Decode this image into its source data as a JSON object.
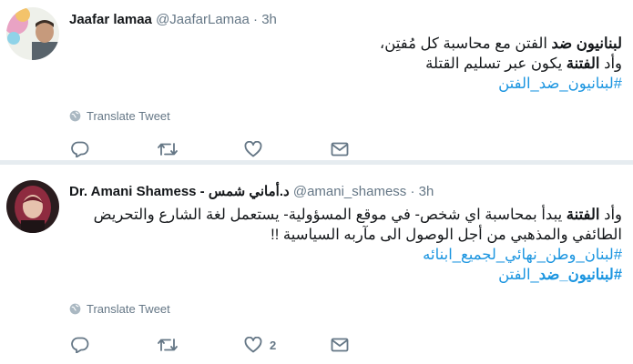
{
  "tweets": [
    {
      "name": "Jaafar lamaa",
      "handle": "@JaafarLamaa",
      "time": "3h",
      "body_line1_bold": "لبنانيون ضد",
      "body_line1_rest": " الفتن مع محاسبة كل مُفتِن،",
      "body_line2_pre": "وأد ",
      "body_line2_bold": "الفتنة",
      "body_line2_rest": " يكون عبر تسليم القتلة",
      "hashtag1": "#لبنانيون_ضد_الفتن",
      "translate": "Translate Tweet",
      "likes": ""
    },
    {
      "name": "Dr. Amani Shamess - د.أماني شمس",
      "handle": "@amani_shamess",
      "time": "3h",
      "body_line1_pre": "وأد ",
      "body_line1_bold": "الفتنة",
      "body_line1_rest": " يبدأ بمحاسبة اي شخص- في موقع المسؤولية- يستعمل لغة الشارع والتحريض",
      "body_line2": "الطائفي والمذهبي من أجل الوصول الى مآربه السياسية !!",
      "hashtag1": "#لبنان_وطن_نهائي_لجميع_ابنائه",
      "hashtag2_bold": "#لبنانيون_ضد",
      "hashtag2_rest": "_الفتن",
      "translate": "Translate Tweet",
      "likes": "2"
    }
  ],
  "icons": [
    "reply-icon",
    "retweet-icon",
    "like-icon",
    "dm-icon",
    "globe-icon"
  ],
  "colors": {
    "link": "#1b95e0",
    "muted": "#657786",
    "divider": "#e6ecf0"
  }
}
